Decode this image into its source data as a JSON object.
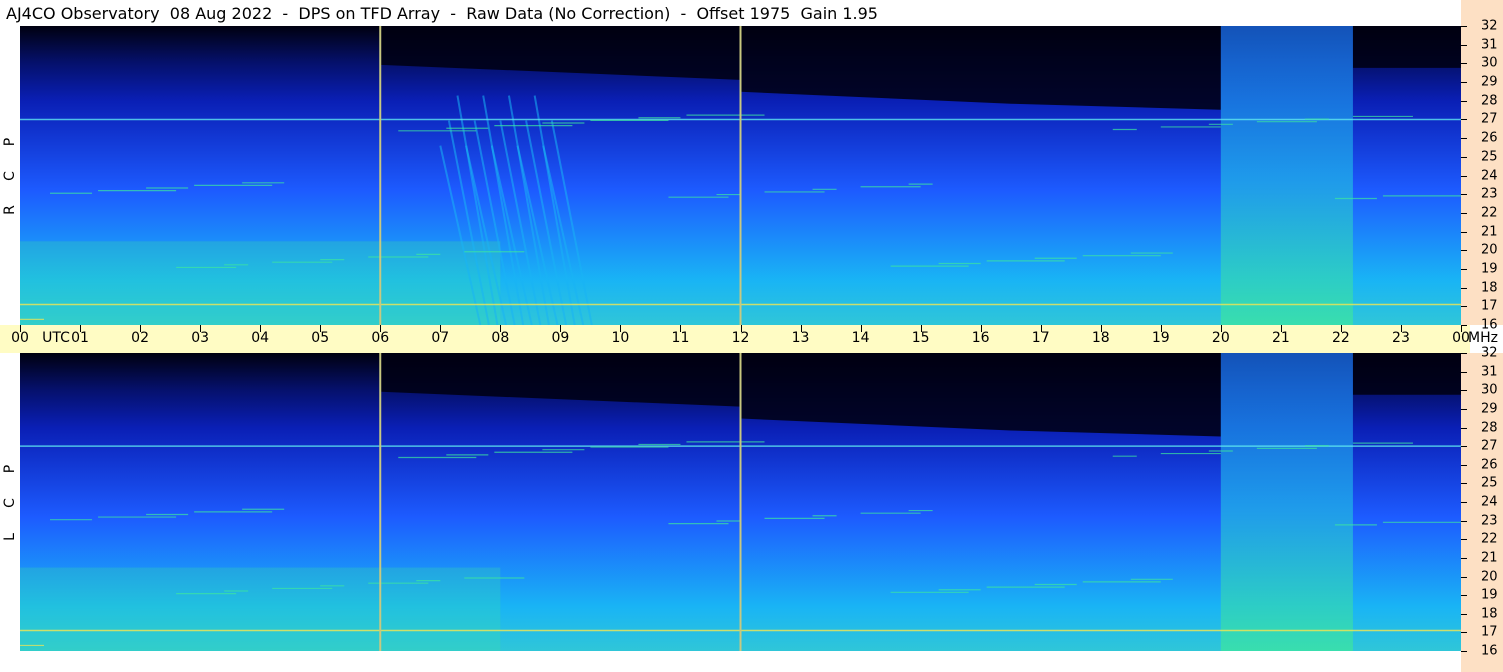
{
  "header": {
    "title": "AJ4CO Observatory  08 Aug 2022  -  DPS on TFD Array  -  Raw Data (No Correction)  -  Offset 1975  Gain 1.95"
  },
  "panels": {
    "top": {
      "polarization": [
        "R",
        "C",
        "P"
      ]
    },
    "bottom": {
      "polarization": [
        "L",
        "C",
        "P"
      ]
    }
  },
  "time_axis": {
    "labels": [
      "00",
      "UTC",
      "01",
      "02",
      "03",
      "04",
      "05",
      "06",
      "07",
      "08",
      "09",
      "10",
      "11",
      "12",
      "13",
      "14",
      "15",
      "16",
      "17",
      "18",
      "19",
      "20",
      "21",
      "22",
      "23",
      "00",
      "MHz"
    ]
  },
  "freq_axis": {
    "labels": [
      "32",
      "31",
      "30",
      "29",
      "28",
      "27",
      "26",
      "25",
      "24",
      "23",
      "22",
      "21",
      "20",
      "19",
      "18",
      "17",
      "16"
    ]
  },
  "colors": {
    "background_dark": "#000010",
    "deep_blue": "#0a1fb5",
    "mid_blue": "#1d5bff",
    "cyan": "#19b4f5",
    "green": "#3ce6a0",
    "yellow": "#f5e650",
    "time_axis_bg": "#fffcc4",
    "freq_axis_bg": "#fde0c4"
  },
  "chart_data": {
    "type": "heatmap",
    "title": "AJ4CO Observatory  08 Aug 2022  -  DPS on TFD Array  -  Raw Data (No Correction)  -  Offset 1975  Gain 1.95",
    "x_range_utc_hours": [
      0,
      24
    ],
    "y_range_mhz": [
      16,
      32
    ],
    "panels": [
      {
        "name": "RCP",
        "label": "R C P"
      },
      {
        "name": "LCP",
        "label": "L C P"
      }
    ],
    "x_ticks": [
      "00",
      "01",
      "02",
      "03",
      "04",
      "05",
      "06",
      "07",
      "08",
      "09",
      "10",
      "11",
      "12",
      "13",
      "14",
      "15",
      "16",
      "17",
      "18",
      "19",
      "20",
      "21",
      "22",
      "23",
      "00"
    ],
    "y_ticks": [
      32,
      31,
      30,
      29,
      28,
      27,
      26,
      25,
      24,
      23,
      22,
      21,
      20,
      19,
      18,
      17,
      16
    ],
    "vertical_markers_utc": [
      6,
      12
    ],
    "features": [
      {
        "type": "drifting_bursts",
        "utc_start": 7.5,
        "utc_end": 9.5
      },
      {
        "type": "enhanced_noise_band",
        "utc_start": 20.0,
        "utc_end": 22.2
      },
      {
        "type": "interference_line_mhz",
        "mhz": 17.1
      },
      {
        "type": "interference_line_mhz",
        "mhz": 27.0
      }
    ]
  }
}
